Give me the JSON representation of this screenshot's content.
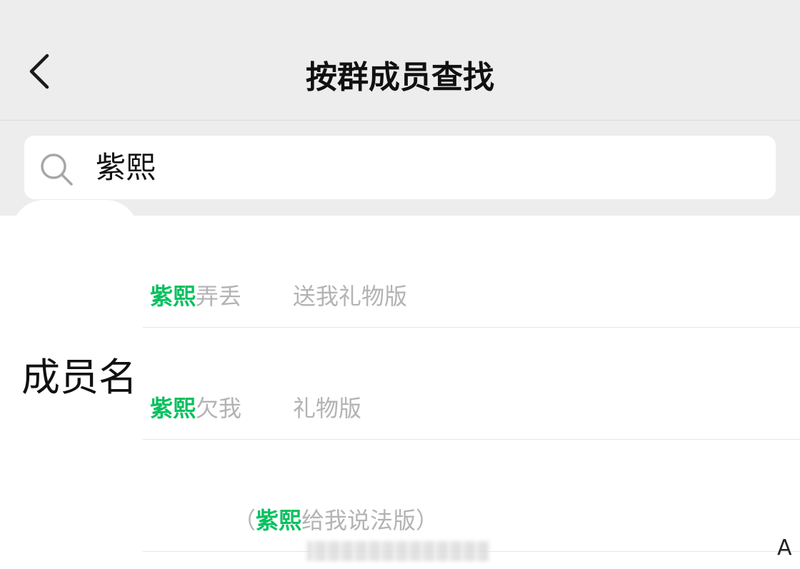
{
  "header": {
    "title": "按群成员查找"
  },
  "search": {
    "query": "紫熙"
  },
  "side_label": "成员名",
  "results": [
    {
      "highlight": "紫熙",
      "rest": "弄丢",
      "extra": "送我礼物版"
    },
    {
      "highlight": "紫熙",
      "rest": "欠我",
      "extra": "礼物版"
    },
    {
      "prefix": "（",
      "highlight": "紫熙",
      "rest": "给我说法版）"
    }
  ],
  "corner_text": "A",
  "colors": {
    "header_bg": "#ededed",
    "highlight": "#07c160",
    "muted_text": "#b3b3b3"
  },
  "icons": {
    "back": "chevron-left-icon",
    "search": "search-icon"
  }
}
